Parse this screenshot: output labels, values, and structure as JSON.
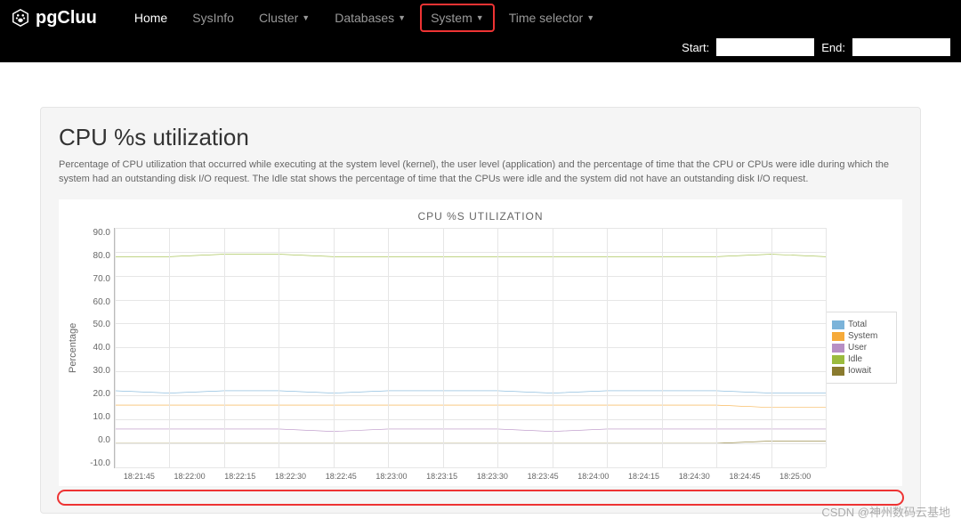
{
  "brand": "pgCluu",
  "nav": {
    "home": "Home",
    "sysinfo": "SysInfo",
    "cluster": "Cluster",
    "databases": "Databases",
    "system": "System",
    "timesel": "Time selector"
  },
  "time": {
    "start_label": "Start:",
    "end_label": "End:",
    "start_value": "",
    "end_value": ""
  },
  "panel": {
    "title": "CPU %s utilization",
    "desc": "Percentage of CPU utilization that occurred while executing at the system level (kernel), the user level (application) and the percentage of time that the CPU or CPUs were idle during which the system had an outstanding disk I/O request. The Idle stat shows the percentage of time that the CPUs were idle and the system did not have an outstanding disk I/O request."
  },
  "watermark": "CSDN @神州数码云基地",
  "chart_data": {
    "type": "line",
    "title": "CPU %S UTILIZATION",
    "ylabel": "Percentage",
    "ylim": [
      -10,
      90
    ],
    "yticks": [
      "90.0",
      "80.0",
      "70.0",
      "60.0",
      "50.0",
      "40.0",
      "30.0",
      "20.0",
      "10.0",
      "0.0",
      "-10.0"
    ],
    "x": [
      "18:21:45",
      "18:22:00",
      "18:22:15",
      "18:22:30",
      "18:22:45",
      "18:23:00",
      "18:23:15",
      "18:23:30",
      "18:23:45",
      "18:24:00",
      "18:24:15",
      "18:24:30",
      "18:24:45",
      "18:25:00"
    ],
    "series": [
      {
        "name": "Total",
        "color": "#7bb3d9",
        "values": [
          22,
          21,
          22,
          22,
          21,
          22,
          22,
          22,
          21,
          22,
          22,
          22,
          21,
          21
        ]
      },
      {
        "name": "System",
        "color": "#f6aa3a",
        "values": [
          16,
          16,
          16,
          16,
          16,
          16,
          16,
          16,
          16,
          16,
          16,
          16,
          15,
          15
        ]
      },
      {
        "name": "User",
        "color": "#b78fc4",
        "values": [
          6,
          6,
          6,
          6,
          5,
          6,
          6,
          6,
          5,
          6,
          6,
          6,
          6,
          6
        ]
      },
      {
        "name": "Idle",
        "color": "#9bbb3e",
        "values": [
          78,
          78,
          79,
          79,
          78,
          78,
          78,
          78,
          78,
          78,
          78,
          78,
          79,
          78
        ]
      },
      {
        "name": "Iowait",
        "color": "#8a7b2f",
        "values": [
          0,
          0,
          0,
          0,
          0,
          0,
          0,
          0,
          0,
          0,
          0,
          0,
          1,
          1
        ]
      }
    ]
  }
}
